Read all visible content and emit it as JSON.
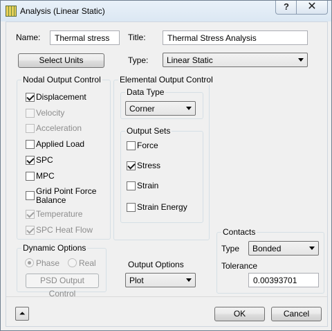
{
  "window": {
    "title": "Analysis (Linear Static)",
    "help_label": "?",
    "close_label": "✕"
  },
  "name": {
    "label": "Name:",
    "value": "Thermal stress"
  },
  "title": {
    "label": "Title:",
    "value": "Thermal Stress Analysis"
  },
  "select_units_label": "Select Units",
  "type": {
    "label": "Type:",
    "value": "Linear Static"
  },
  "nodal": {
    "label": "Nodal Output Control",
    "items": [
      {
        "label": "Displacement",
        "checked": true,
        "enabled": true
      },
      {
        "label": "Velocity",
        "checked": false,
        "enabled": false
      },
      {
        "label": "Acceleration",
        "checked": false,
        "enabled": false
      },
      {
        "label": "Applied Load",
        "checked": false,
        "enabled": true
      },
      {
        "label": "SPC",
        "checked": true,
        "enabled": true
      },
      {
        "label": "MPC",
        "checked": false,
        "enabled": true
      },
      {
        "label_line1": "Grid Point Force",
        "label_line2": "Balance",
        "checked": false,
        "enabled": true
      },
      {
        "label": "Temperature",
        "checked": true,
        "enabled": false
      },
      {
        "label": "SPC Heat Flow",
        "checked": true,
        "enabled": false
      }
    ]
  },
  "elemental": {
    "label": "Elemental Output Control",
    "data_type": {
      "label": "Data Type",
      "value": "Corner"
    },
    "output_sets": {
      "label": "Output Sets",
      "items": [
        {
          "label": "Force",
          "checked": false
        },
        {
          "label": "Stress",
          "checked": true
        },
        {
          "label": "Strain",
          "checked": false
        },
        {
          "label": "Strain Energy",
          "checked": false
        }
      ]
    }
  },
  "dynamic": {
    "label": "Dynamic Options",
    "phase_label": "Phase",
    "real_label": "Real",
    "psd_button_label": "PSD Output Control"
  },
  "output_options": {
    "label": "Output Options",
    "value": "Plot"
  },
  "contacts": {
    "label": "Contacts",
    "type_label": "Type",
    "type_value": "Bonded",
    "tolerance_label": "Tolerance",
    "tolerance_value": "0.00393701"
  },
  "footer": {
    "expander_icon": "double-chevron-up",
    "expander_glyph": "⏶",
    "ok_label": "OK",
    "cancel_label": "Cancel"
  }
}
